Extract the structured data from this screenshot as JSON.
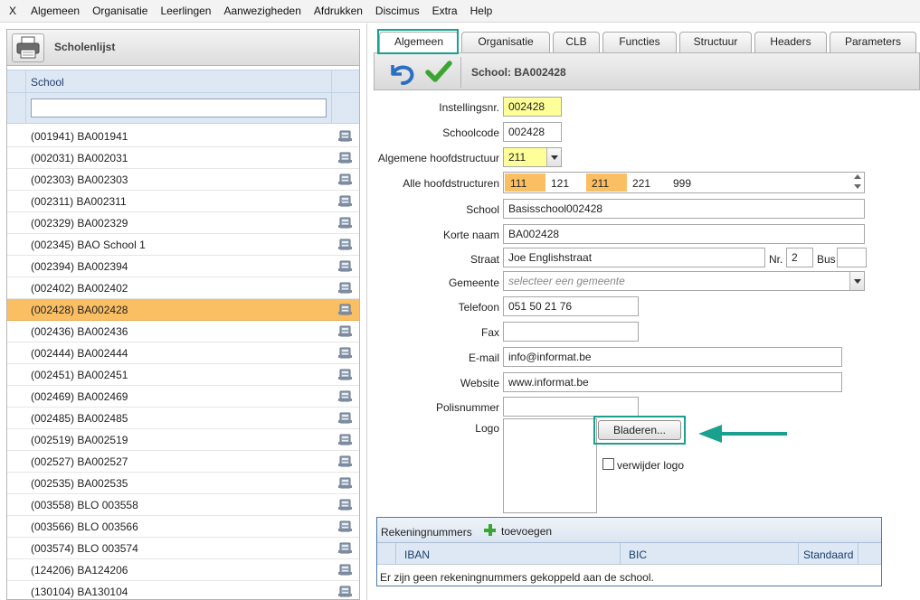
{
  "menu": [
    "X",
    "Algemeen",
    "Organisatie",
    "Leerlingen",
    "Aanwezigheden",
    "Afdrukken",
    "Discimus",
    "Extra",
    "Help"
  ],
  "left_panel": {
    "title": "Scholenlijst",
    "column_header": "School",
    "filter_value": "",
    "rows": [
      "(001941) BA001941",
      "(002031) BA002031",
      "(002303) BA002303",
      "(002311) BA002311",
      "(002329) BA002329",
      "(002345) BAO School 1",
      "(002394) BA002394",
      "(002402) BA002402",
      "(002428) BA002428",
      "(002436) BA002436",
      "(002444) BA002444",
      "(002451) BA002451",
      "(002469) BA002469",
      "(002485) BA002485",
      "(002519) BA002519",
      "(002527) BA002527",
      "(002535) BA002535",
      "(003558) BLO 003558",
      "(003566) BLO 003566",
      "(003574) BLO 003574",
      "(124206) BA124206",
      "(130104) BA130104"
    ],
    "selected_index": 8
  },
  "tabs": [
    "Algemeen",
    "Organisatie",
    "CLB",
    "Functies",
    "Structuur",
    "Headers",
    "Parameters"
  ],
  "active_tab": "Algemeen",
  "toolbar": {
    "title": "School: BA002428"
  },
  "form": {
    "instellingsnr": {
      "label": "Instellingsnr.",
      "value": "002428"
    },
    "schoolcode": {
      "label": "Schoolcode",
      "value": "002428"
    },
    "hoofdstructuur": {
      "label": "Algemene hoofdstructuur",
      "value": "211"
    },
    "alle_hoofdstructuren": {
      "label": "Alle hoofdstructuren",
      "items": [
        "111",
        "121",
        "211",
        "221",
        "999"
      ],
      "selected": [
        "111",
        "211"
      ]
    },
    "school": {
      "label": "School",
      "value": "Basisschool002428"
    },
    "korte_naam": {
      "label": "Korte naam",
      "value": "BA002428"
    },
    "straat": {
      "label": "Straat",
      "value": "Joe Englishstraat"
    },
    "nr": {
      "label": "Nr.",
      "value": "2"
    },
    "bus": {
      "label": "Bus",
      "value": ""
    },
    "gemeente": {
      "label": "Gemeente",
      "placeholder": "selecteer een gemeente"
    },
    "telefoon": {
      "label": "Telefoon",
      "value": "051 50 21 76"
    },
    "fax": {
      "label": "Fax",
      "value": ""
    },
    "email": {
      "label": "E-mail",
      "value": "info@informat.be"
    },
    "website": {
      "label": "Website",
      "value": "www.informat.be"
    },
    "polisnummer": {
      "label": "Polisnummer",
      "value": ""
    },
    "logo": {
      "label": "Logo",
      "browse": "Bladeren...",
      "remove": "verwijder logo",
      "remove_checked": false
    }
  },
  "accounts": {
    "title": "Rekeningnummers",
    "add": "toevoegen",
    "columns": [
      "IBAN",
      "BIC",
      "Standaard"
    ],
    "empty_message": "Er zijn geen rekeningnummers gekoppeld aan de school."
  },
  "colors": {
    "highlight": "#1aa08e",
    "selection": "#fbbf63",
    "required_field": "#ffff99",
    "grid_header": "#dde8f4"
  },
  "icons": [
    "printer-icon",
    "undo-icon",
    "checkmark-icon",
    "school-card-icon",
    "plus-icon",
    "arrow-left-icon"
  ]
}
